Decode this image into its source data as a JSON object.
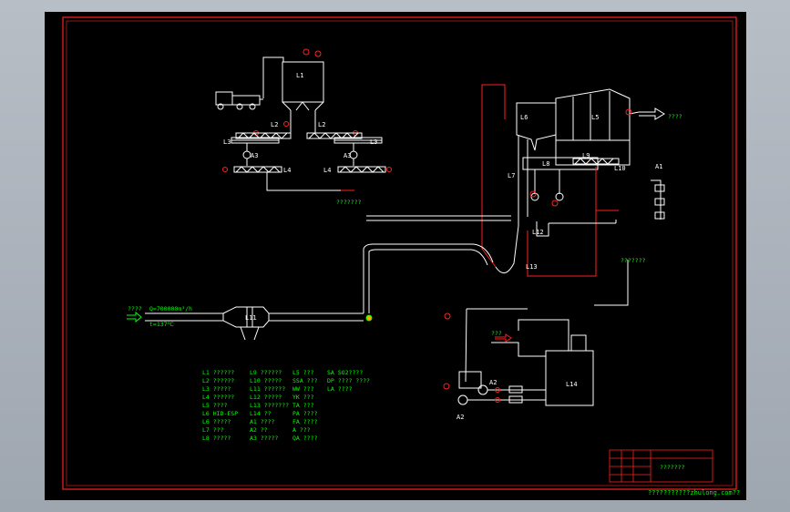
{
  "colors": {
    "background": "#a9b0b9",
    "sheet": "#000000",
    "border": "#ff2020",
    "pipe": "#ffffff",
    "signal": "#ff2020",
    "label": "#00ff00"
  },
  "equipment": {
    "L1": "L1",
    "L2": "L2",
    "L3": "L3",
    "L4": "L4",
    "L5": "L5",
    "L6": "L6",
    "L7": "L7",
    "L8": "L8",
    "L9": "L9",
    "L10": "L10",
    "L11": "L11",
    "L12": "L12",
    "L13": "L13",
    "L14": "L14",
    "A1": "A1",
    "A2": "A2",
    "A3": "A3"
  },
  "annotations": {
    "outlet": "????",
    "l4_outlet": "???????",
    "steam_up": "???????",
    "inlet_arrow": "????",
    "inlet_flow": "Q=700000m³/h",
    "inlet_temp": "t=137℃",
    "side_arrow": "???"
  },
  "legend": [
    "L1 ??????",
    "L2 ??????",
    "L3 ?????",
    "L4 ??????",
    "L5 ????",
    "L6 HID-ESP",
    "L6 ?????",
    "L7 ???",
    "L8 ?????",
    "L9 ??????",
    "L10 ?????",
    "L11 ??????",
    "L12 ?????",
    "L13 ???????",
    "L14 ??",
    "A1 ????",
    "A2 ??",
    "A3 ?????",
    "L5 ???",
    "SSA ???",
    "WW ???",
    "YK ???",
    "TA ???",
    "PA ????",
    "FA ????",
    "A ???",
    "QA ????",
    "SA SO2????",
    "DP ???? ????",
    "LA ????"
  ],
  "title_block": {
    "title": "???????"
  },
  "footer": "???????????zhulong.com??"
}
